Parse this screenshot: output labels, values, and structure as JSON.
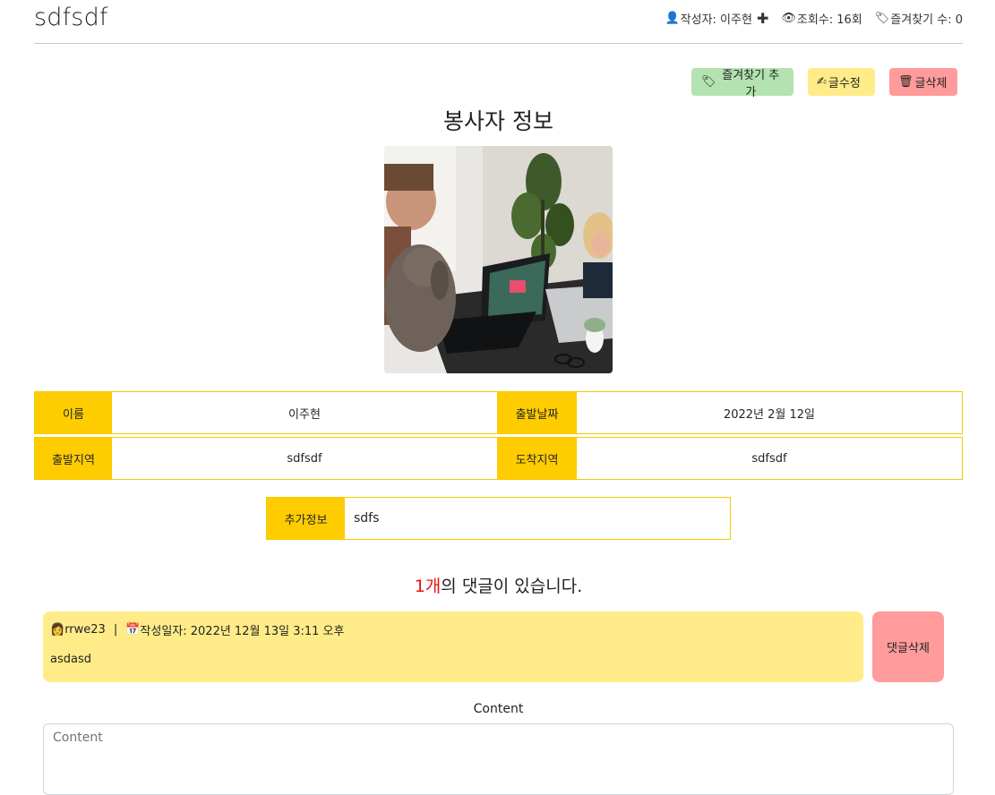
{
  "post": {
    "title": "sdfsdf",
    "author_label": "작성자: 이주현",
    "views_label": "조회수: 16회",
    "favorites_label": "즐겨찾기 수: 0"
  },
  "actions": {
    "favorite_add": "즐겨찾기 추가",
    "edit": "글수정",
    "delete": "글삭제"
  },
  "section_title": "봉사자 정보",
  "info": {
    "name_label": "이름",
    "name_value": "이주현",
    "depart_date_label": "출발날짜",
    "depart_date_value": "2022년 2월 12일",
    "depart_region_label": "출발지역",
    "depart_region_value": "sdfsdf",
    "arrive_region_label": "도착지역",
    "arrive_region_value": "sdfsdf",
    "extra_label": "추가정보",
    "extra_value": "sdfs"
  },
  "comments": {
    "count": "1개",
    "count_suffix": "의 댓글이 있습니다.",
    "items": [
      {
        "author": "rrwe23",
        "separator": "|",
        "date_label": "작성일자: 2022년 12월 13일 3:11 오후",
        "body": "asdasd",
        "delete_label": "댓글삭제"
      }
    ]
  },
  "form": {
    "content_label": "Content",
    "content_placeholder": "Content"
  },
  "colors": {
    "label_bg": "#ffcc00",
    "comment_bg": "#ffec88",
    "green_btn": "#b4e2b0",
    "red_btn": "#ff9b9b",
    "count_accent": "#ee1111"
  }
}
